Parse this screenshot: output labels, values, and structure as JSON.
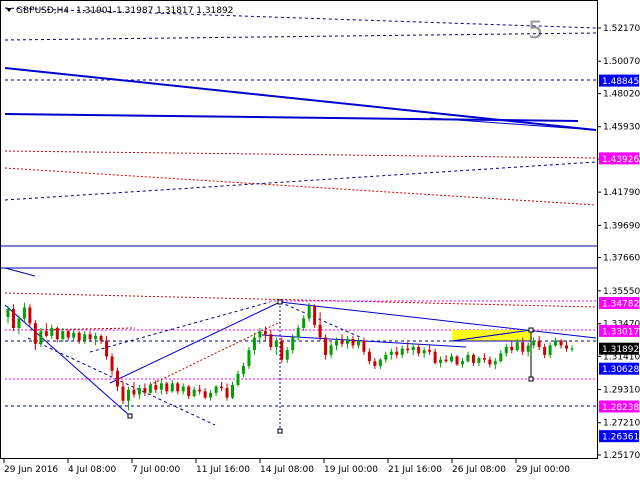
{
  "header": {
    "symbol": "GBPUSD,H4",
    "ohlc": "1.31901 1.31987 1.31817 1.31892",
    "wave_label": "5"
  },
  "colors": {
    "background": "#ffffff",
    "frame": "#000000",
    "text": "#000000",
    "trend_blue": "#0000cc",
    "dashed_red": "#cc0000",
    "dashed_blue": "#0000aa",
    "fib_pink": "#ff00ff",
    "bull_candle": "#00a000",
    "bear_candle": "#cc0000",
    "highlight_box": "#ffff00",
    "price_label_bg": "#0000ff",
    "price_label_pink": "#ff00ff",
    "current_price_bg": "#000000",
    "wave_label_color": "#999999"
  },
  "chart_data": {
    "type": "candlestick",
    "title": "GBPUSD,H4",
    "y_axis": {
      "min": 1.2517,
      "max": 1.5217,
      "ticks": [
        "1.52170",
        "1.50070",
        "1.48020",
        "1.45930",
        "1.43880",
        "1.41790",
        "1.39690",
        "1.37660",
        "1.35550",
        "1.33470",
        "1.31410",
        "1.29310",
        "1.27210",
        "1.25170"
      ]
    },
    "x_axis": {
      "ticks": [
        "29 Jun 2016",
        "4 Jul 08:00",
        "7 Jul 00:00",
        "11 Jul 16:00",
        "14 Jul 08:00",
        "19 Jul 00:00",
        "21 Jul 16:00",
        "26 Jul 08:00",
        "29 Jul 00:00"
      ]
    },
    "price_labels": [
      {
        "value": "1.48845",
        "style": "blue"
      },
      {
        "value": "1.43926",
        "style": "pink"
      },
      {
        "value": "1.34782",
        "style": "pink"
      },
      {
        "value": "1.33017",
        "style": "pink"
      },
      {
        "value": "1.31892",
        "style": "current"
      },
      {
        "value": "1.30628",
        "style": "blue"
      },
      {
        "value": "1.28238",
        "style": "pink"
      },
      {
        "value": "1.26361",
        "style": "blue"
      }
    ],
    "candles": [
      [
        1.339,
        1.346,
        1.335,
        1.344
      ],
      [
        1.344,
        1.347,
        1.33,
        1.332
      ],
      [
        1.332,
        1.34,
        1.328,
        1.338
      ],
      [
        1.338,
        1.348,
        1.336,
        1.345
      ],
      [
        1.345,
        1.347,
        1.333,
        1.335
      ],
      [
        1.335,
        1.337,
        1.318,
        1.322
      ],
      [
        1.322,
        1.332,
        1.32,
        1.33
      ],
      [
        1.33,
        1.335,
        1.326,
        1.327
      ],
      [
        1.327,
        1.334,
        1.325,
        1.332
      ],
      [
        1.332,
        1.333,
        1.323,
        1.325
      ],
      [
        1.325,
        1.332,
        1.323,
        1.33
      ],
      [
        1.33,
        1.331,
        1.324,
        1.326
      ],
      [
        1.326,
        1.331,
        1.324,
        1.329
      ],
      [
        1.329,
        1.33,
        1.322,
        1.324
      ],
      [
        1.324,
        1.33,
        1.322,
        1.328
      ],
      [
        1.328,
        1.33,
        1.323,
        1.325
      ],
      [
        1.325,
        1.329,
        1.321,
        1.327
      ],
      [
        1.327,
        1.328,
        1.322,
        1.324
      ],
      [
        1.324,
        1.327,
        1.312,
        1.314
      ],
      [
        1.314,
        1.316,
        1.302,
        1.305
      ],
      [
        1.305,
        1.307,
        1.292,
        1.295
      ],
      [
        1.295,
        1.298,
        1.284,
        1.286
      ],
      [
        1.286,
        1.295,
        1.28,
        1.293
      ],
      [
        1.293,
        1.298,
        1.288,
        1.29
      ],
      [
        1.29,
        1.296,
        1.287,
        1.294
      ],
      [
        1.294,
        1.297,
        1.289,
        1.291
      ],
      [
        1.291,
        1.298,
        1.29,
        1.296
      ],
      [
        1.296,
        1.299,
        1.291,
        1.293
      ],
      [
        1.293,
        1.299,
        1.29,
        1.297
      ],
      [
        1.297,
        1.298,
        1.29,
        1.292
      ],
      [
        1.292,
        1.299,
        1.291,
        1.297
      ],
      [
        1.297,
        1.298,
        1.29,
        1.292
      ],
      [
        1.292,
        1.297,
        1.29,
        1.295
      ],
      [
        1.295,
        1.296,
        1.287,
        1.289
      ],
      [
        1.289,
        1.295,
        1.288,
        1.293
      ],
      [
        1.293,
        1.296,
        1.29,
        1.292
      ],
      [
        1.292,
        1.294,
        1.287,
        1.288
      ],
      [
        1.288,
        1.293,
        1.286,
        1.291
      ],
      [
        1.291,
        1.296,
        1.289,
        1.295
      ],
      [
        1.295,
        1.298,
        1.292,
        1.294
      ],
      [
        1.294,
        1.297,
        1.286,
        1.288
      ],
      [
        1.288,
        1.298,
        1.287,
        1.296
      ],
      [
        1.296,
        1.305,
        1.295,
        1.303
      ],
      [
        1.303,
        1.31,
        1.301,
        1.308
      ],
      [
        1.308,
        1.32,
        1.306,
        1.318
      ],
      [
        1.318,
        1.329,
        1.315,
        1.326
      ],
      [
        1.326,
        1.332,
        1.322,
        1.33
      ],
      [
        1.33,
        1.333,
        1.324,
        1.328
      ],
      [
        1.328,
        1.331,
        1.318,
        1.32
      ],
      [
        1.32,
        1.326,
        1.315,
        1.324
      ],
      [
        1.324,
        1.326,
        1.31,
        1.312
      ],
      [
        1.312,
        1.32,
        1.31,
        1.318
      ],
      [
        1.318,
        1.328,
        1.316,
        1.326
      ],
      [
        1.326,
        1.334,
        1.324,
        1.332
      ],
      [
        1.332,
        1.34,
        1.33,
        1.338
      ],
      [
        1.338,
        1.348,
        1.336,
        1.346
      ],
      [
        1.346,
        1.347,
        1.332,
        1.334
      ],
      [
        1.334,
        1.342,
        1.324,
        1.326
      ],
      [
        1.326,
        1.328,
        1.312,
        1.315
      ],
      [
        1.315,
        1.323,
        1.313,
        1.321
      ],
      [
        1.321,
        1.326,
        1.318,
        1.324
      ],
      [
        1.324,
        1.328,
        1.32,
        1.322
      ],
      [
        1.322,
        1.327,
        1.319,
        1.325
      ],
      [
        1.325,
        1.327,
        1.319,
        1.321
      ],
      [
        1.321,
        1.326,
        1.319,
        1.324
      ],
      [
        1.324,
        1.326,
        1.315,
        1.317
      ],
      [
        1.317,
        1.319,
        1.309,
        1.311
      ],
      [
        1.311,
        1.313,
        1.306,
        1.308
      ],
      [
        1.308,
        1.313,
        1.306,
        1.312
      ],
      [
        1.312,
        1.317,
        1.31,
        1.315
      ],
      [
        1.315,
        1.319,
        1.312,
        1.317
      ],
      [
        1.317,
        1.32,
        1.313,
        1.315
      ],
      [
        1.315,
        1.321,
        1.313,
        1.319
      ],
      [
        1.319,
        1.323,
        1.316,
        1.318
      ],
      [
        1.318,
        1.322,
        1.315,
        1.32
      ],
      [
        1.32,
        1.322,
        1.314,
        1.316
      ],
      [
        1.316,
        1.32,
        1.313,
        1.318
      ],
      [
        1.318,
        1.321,
        1.315,
        1.317
      ],
      [
        1.317,
        1.319,
        1.309,
        1.31
      ],
      [
        1.31,
        1.314,
        1.307,
        1.312
      ],
      [
        1.312,
        1.315,
        1.31,
        1.311
      ],
      [
        1.311,
        1.316,
        1.31,
        1.314
      ],
      [
        1.314,
        1.315,
        1.308,
        1.309
      ],
      [
        1.309,
        1.313,
        1.307,
        1.311
      ],
      [
        1.311,
        1.317,
        1.31,
        1.315
      ],
      [
        1.315,
        1.316,
        1.308,
        1.31
      ],
      [
        1.31,
        1.314,
        1.308,
        1.313
      ],
      [
        1.313,
        1.316,
        1.31,
        1.312
      ],
      [
        1.312,
        1.314,
        1.307,
        1.309
      ],
      [
        1.309,
        1.313,
        1.306,
        1.311
      ],
      [
        1.311,
        1.318,
        1.31,
        1.316
      ],
      [
        1.316,
        1.322,
        1.314,
        1.32
      ],
      [
        1.32,
        1.324,
        1.316,
        1.318
      ],
      [
        1.318,
        1.325,
        1.317,
        1.323
      ],
      [
        1.323,
        1.326,
        1.315,
        1.317
      ],
      [
        1.317,
        1.323,
        1.314,
        1.321
      ],
      [
        1.321,
        1.326,
        1.319,
        1.324
      ],
      [
        1.324,
        1.327,
        1.318,
        1.32
      ],
      [
        1.32,
        1.322,
        1.313,
        1.315
      ],
      [
        1.315,
        1.323,
        1.313,
        1.321
      ],
      [
        1.321,
        1.326,
        1.32,
        1.324
      ],
      [
        1.324,
        1.325,
        1.319,
        1.321
      ],
      [
        1.321,
        1.324,
        1.317,
        1.319
      ],
      [
        1.319,
        1.321,
        1.317,
        1.319
      ]
    ]
  }
}
